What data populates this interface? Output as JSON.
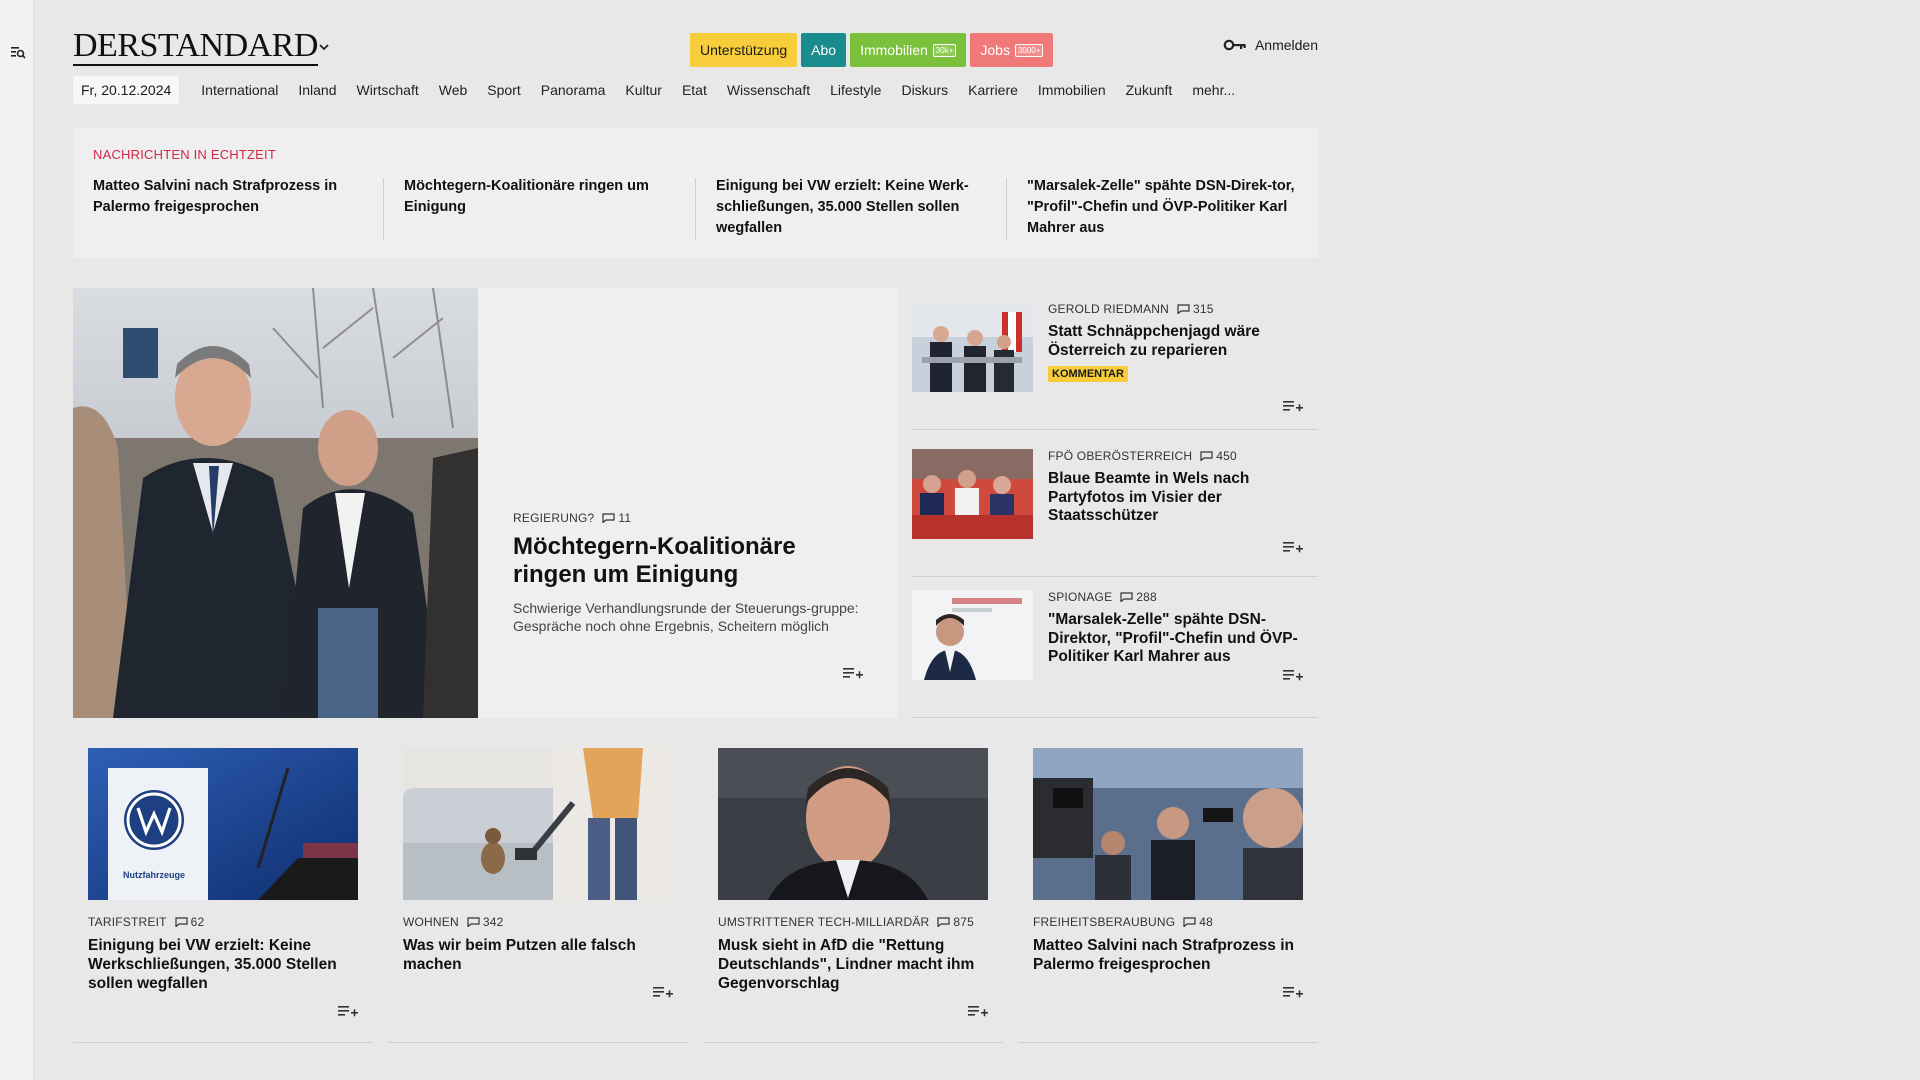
{
  "brand": {
    "logo_text": "DERSTANDARD"
  },
  "header": {
    "buttons": {
      "support": "Unterstützung",
      "abo": "Abo",
      "immo": "Immobilien",
      "immo_pill": "30k+",
      "jobs": "Jobs",
      "jobs_pill": "3000+"
    },
    "login": "Anmelden"
  },
  "nav": {
    "date": "Fr, 20.12.2024",
    "items": [
      "International",
      "Inland",
      "Wirtschaft",
      "Web",
      "Sport",
      "Panorama",
      "Kultur",
      "Etat",
      "Wissenschaft",
      "Lifestyle",
      "Diskurs",
      "Karriere",
      "Immobilien",
      "Zukunft",
      "mehr..."
    ]
  },
  "ticker": {
    "label": "NACHRICHTEN IN ECHTZEIT",
    "items": [
      "Matteo Salvini nach Strafprozess in Palermo freigesprochen",
      "Möchtegern-Koalitionäre ringen um Einigung",
      "Einigung bei VW erzielt: Keine Werk-schließungen, 35.000 Stellen sollen wegfallen",
      "\"Marsalek-Zelle\" spähte DSN-Direk-tor, \"Profil\"-Chefin und ÖVP-Politiker Karl Mahrer aus"
    ]
  },
  "lead": {
    "kicker": "REGIERUNG?",
    "comments": "11",
    "headline": "Möchtegern-Koalitionäre ringen um Einigung",
    "teaser": "Schwierige Verhandlungsrunde der Steuerungs-gruppe: Gespräche noch ohne Ergebnis, Scheitern möglich"
  },
  "side": [
    {
      "kicker": "GEROLD RIEDMANN",
      "comments": "315",
      "title": "Statt Schnäppchenjagd wäre Österreich zu reparieren",
      "badge": "KOMMENTAR"
    },
    {
      "kicker": "FPÖ OBERÖSTERREICH",
      "comments": "450",
      "title": "Blaue Beamte in Wels nach Partyfotos im Visier der Staatsschützer"
    },
    {
      "kicker": "SPIONAGE",
      "comments": "288",
      "title": "\"Marsalek-Zelle\" spähte DSN-Direktor, \"Profil\"-Chefin und ÖVP-Politiker Karl Mahrer aus"
    }
  ],
  "grid": [
    {
      "kicker": "TARIFSTREIT",
      "comments": "62",
      "title": "Einigung bei VW erzielt: Keine Werkschließungen, 35.000 Stellen sollen wegfallen",
      "img_text": "Nutzfahrzeuge"
    },
    {
      "kicker": "WOHNEN",
      "comments": "342",
      "title": "Was wir beim Putzen alle falsch machen"
    },
    {
      "kicker": "UMSTRITTENER TECH-MILLIARDÄR",
      "comments": "875",
      "title": "Musk sieht in AfD die \"Rettung Deutschlands\", Lindner macht ihm Gegenvorschlag"
    },
    {
      "kicker": "FREIHEITSBERAUBUNG",
      "comments": "48",
      "title": "Matteo Salvini nach Strafprozess in Palermo freigesprochen"
    }
  ],
  "colors": {
    "background": "#e8e8e8",
    "card": "#efefef",
    "ticker_label": "#d0294a",
    "support": "#f7cd3b",
    "abo": "#1b8c8d",
    "immobilien": "#7cc13c",
    "jobs": "#f07a7a"
  },
  "icons": [
    "search-menu-icon",
    "chevron-down-icon",
    "key-icon",
    "comment-icon",
    "add-to-list-icon"
  ]
}
